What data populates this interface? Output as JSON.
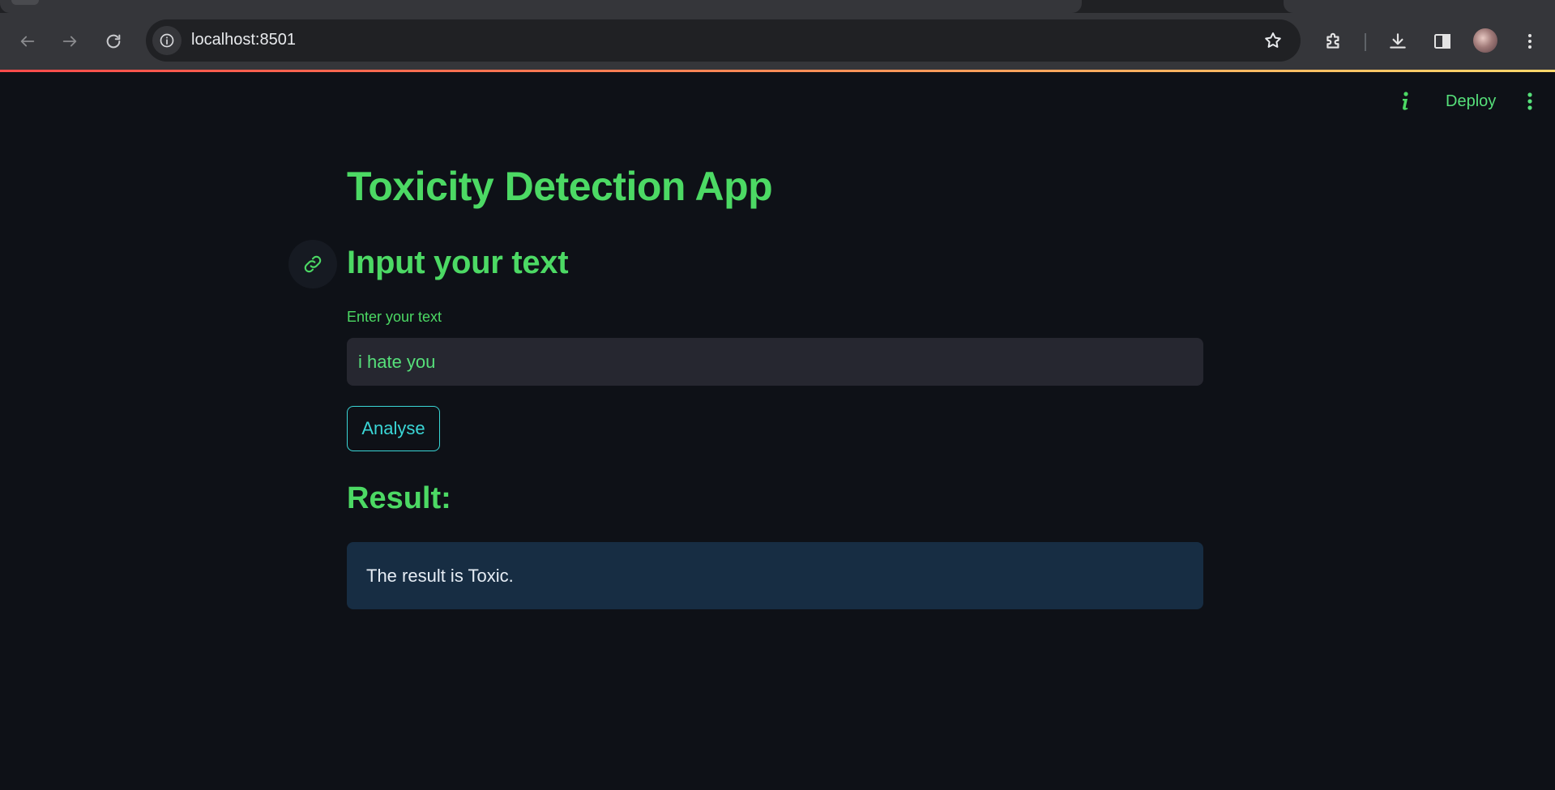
{
  "browser": {
    "url": "localhost:8501",
    "icons": {
      "back": "arrow-left-icon",
      "forward": "arrow-right-icon",
      "reload": "reload-icon",
      "site_info": "info-circle-icon",
      "bookmark": "star-icon",
      "extensions": "puzzle-icon",
      "downloads": "download-icon",
      "side_panel": "side-panel-icon",
      "menu": "kebab-menu-icon"
    },
    "colors": {
      "loadbar_start": "#ff4b4b",
      "loadbar_end": "#ffd86b"
    }
  },
  "app_header": {
    "deploy_label": "Deploy",
    "icons": {
      "info": "info-icon",
      "menu": "kebab-menu-icon"
    }
  },
  "main": {
    "title": "Toxicity Detection App",
    "input_section_title": "Input your text",
    "input_label": "Enter your text",
    "input_value": "i hate you",
    "analyse_label": "Analyse",
    "result_title": "Result:",
    "result_message": "The result is Toxic."
  },
  "colors": {
    "background": "#0e1117",
    "primary_text": "#4cd964",
    "button_accent": "#3ad6d6",
    "input_bg": "#262730",
    "result_bg": "#172d43"
  }
}
